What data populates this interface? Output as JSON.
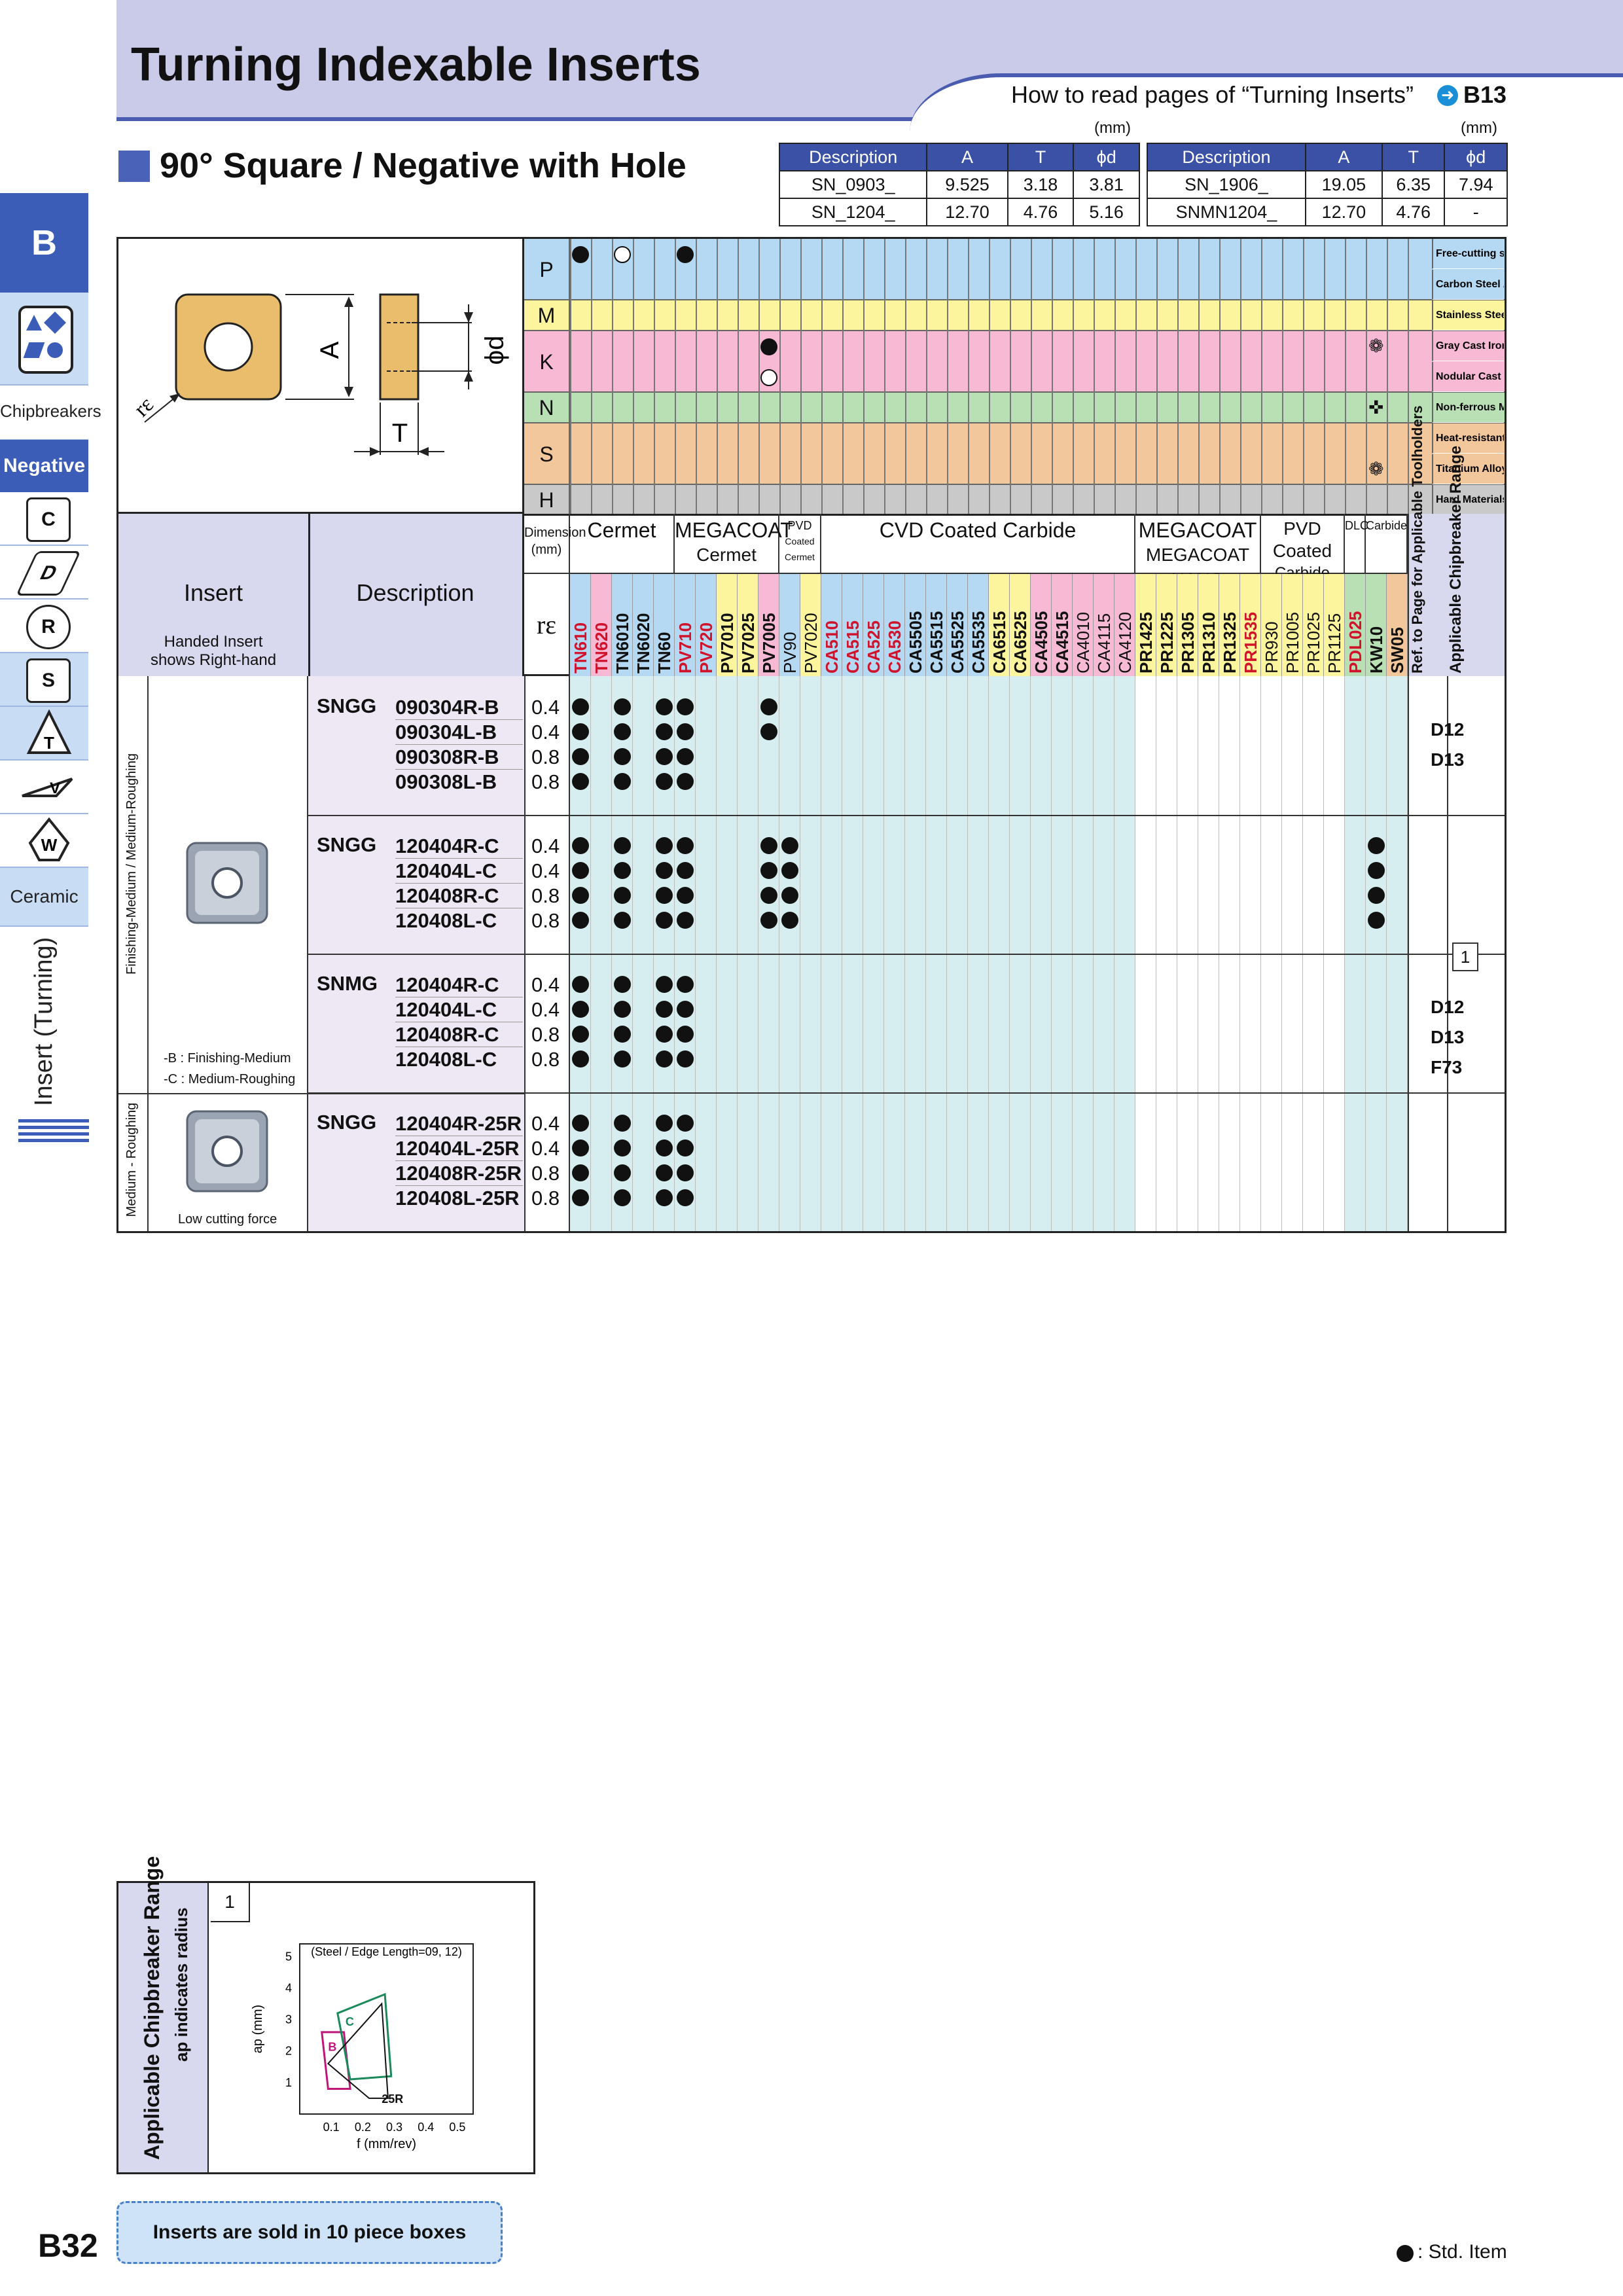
{
  "header": {
    "title": "Turning Indexable Inserts",
    "howto_text": "How to read pages of “Turning Inserts”",
    "howto_ref": "B13",
    "unit": "(mm)"
  },
  "section": {
    "title": "90° Square / Negative with Hole"
  },
  "dim_table": {
    "columns": [
      "Description",
      "A",
      "T",
      "ϕd"
    ],
    "left_rows": [
      [
        "SN_0903_",
        "9.525",
        "3.18",
        "3.81"
      ],
      [
        "SN_1204_",
        "12.70",
        "4.76",
        "5.16"
      ]
    ],
    "right_rows": [
      [
        "SN_1906_",
        "19.05",
        "6.35",
        "7.94"
      ],
      [
        "SNMN1204_",
        "12.70",
        "4.76",
        "-"
      ]
    ]
  },
  "sidebar": {
    "letter": "B",
    "chipbreakers": "Chipbreakers",
    "negative": "Negative",
    "shapes": [
      "C",
      "D",
      "R",
      "S",
      "T",
      "V",
      "W"
    ],
    "ceramic": "Ceramic",
    "vertical": "Insert (Turning)"
  },
  "drawing": {
    "a": "A",
    "t": "T",
    "d": "ϕd",
    "re": "rε"
  },
  "materials": [
    {
      "code": "P",
      "color": "#b5d9f3",
      "labels": [
        "Free-cutting steel",
        "Carbon Steel / Alloy Steel"
      ]
    },
    {
      "code": "M",
      "color": "#fdf59d",
      "labels": [
        "Stainless Steel"
      ]
    },
    {
      "code": "K",
      "color": "#f7b9d4",
      "labels": [
        "Gray Cast Iron",
        "Nodular Cast Iron"
      ]
    },
    {
      "code": "N",
      "color": "#b9dfb4",
      "labels": [
        "Non-ferrous Metals"
      ]
    },
    {
      "code": "S",
      "color": "#f3c79c",
      "labels": [
        "Heat-resistant Alloys",
        "Titanium Alloys"
      ]
    },
    {
      "code": "H",
      "color": "#c9c9c9",
      "labels": [
        "Hard Materials"
      ]
    }
  ],
  "table_header": {
    "insert": "Insert",
    "handed": "Handed Insert\nshows Right-hand",
    "description": "Description",
    "dimension": "Dimension (mm)",
    "re": "rε",
    "ref_page": "Ref. to Page for Applicable Toolholders",
    "chip_range": "Applicable Chipbreaker Range"
  },
  "grade_groups": [
    {
      "name": "Cermet",
      "sub": ""
    },
    {
      "name": "MEGACOAT",
      "sub": "Cermet"
    },
    {
      "name": "PVD",
      "sub": "Coated Cermet"
    },
    {
      "name": "CVD Coated Carbide",
      "sub": ""
    },
    {
      "name": "MEGACOAT",
      "sub": "MEGACOAT NANO"
    },
    {
      "name": "PVD Coated",
      "sub": "Carbide"
    },
    {
      "name": "DLC",
      "sub": ""
    },
    {
      "name": "Carbide",
      "sub": ""
    }
  ],
  "grades": [
    {
      "name": "TN610",
      "red": true
    },
    {
      "name": "TN620",
      "red": true
    },
    {
      "name": "TN6010",
      "red": false
    },
    {
      "name": "TN6020",
      "red": false
    },
    {
      "name": "TN60",
      "red": false
    },
    {
      "name": "PV710",
      "red": true
    },
    {
      "name": "PV720",
      "red": true
    },
    {
      "name": "PV7010",
      "red": false
    },
    {
      "name": "PV7025",
      "red": false
    },
    {
      "name": "PV7005",
      "red": false
    },
    {
      "name": "PV90",
      "red": false
    },
    {
      "name": "PV7020",
      "red": false
    },
    {
      "name": "CA510",
      "red": true
    },
    {
      "name": "CA515",
      "red": true
    },
    {
      "name": "CA525",
      "red": true
    },
    {
      "name": "CA530",
      "red": true
    },
    {
      "name": "CA5505",
      "red": false
    },
    {
      "name": "CA5515",
      "red": false
    },
    {
      "name": "CA5525",
      "red": false
    },
    {
      "name": "CA5535",
      "red": false
    },
    {
      "name": "CA6515",
      "red": false
    },
    {
      "name": "CA6525",
      "red": false
    },
    {
      "name": "CA4505",
      "red": false
    },
    {
      "name": "CA4515",
      "red": false
    },
    {
      "name": "CA4010",
      "red": false
    },
    {
      "name": "CA4115",
      "red": false
    },
    {
      "name": "CA4120",
      "red": false
    },
    {
      "name": "PR1425",
      "red": false
    },
    {
      "name": "PR1225",
      "red": false
    },
    {
      "name": "PR1305",
      "red": false
    },
    {
      "name": "PR1310",
      "red": false
    },
    {
      "name": "PR1325",
      "red": false
    },
    {
      "name": "PR1535",
      "red": true
    },
    {
      "name": "PR930",
      "red": false
    },
    {
      "name": "PR1005",
      "red": false
    },
    {
      "name": "PR1025",
      "red": false
    },
    {
      "name": "PR1125",
      "red": false
    },
    {
      "name": "PDL025",
      "red": true
    },
    {
      "name": "KW10",
      "red": false
    },
    {
      "name": "SW05",
      "red": false
    }
  ],
  "row_groups": [
    {
      "series": "SNGG",
      "rows": [
        {
          "code": "090304R-B",
          "re": "0.4"
        },
        {
          "code": "090304L-B",
          "re": "0.4"
        },
        {
          "code": "090308R-B",
          "re": "0.8"
        },
        {
          "code": "090308L-B",
          "re": "0.8"
        }
      ],
      "refs": [
        "D12",
        "D13"
      ]
    },
    {
      "series": "SNGG",
      "rows": [
        {
          "code": "120404R-C",
          "re": "0.4"
        },
        {
          "code": "120404L-C",
          "re": "0.4"
        },
        {
          "code": "120408R-C",
          "re": "0.8"
        },
        {
          "code": "120408L-C",
          "re": "0.8"
        }
      ],
      "refs": []
    },
    {
      "series": "SNMG",
      "rows": [
        {
          "code": "120404R-C",
          "re": "0.4"
        },
        {
          "code": "120404L-C",
          "re": "0.4"
        },
        {
          "code": "120408R-C",
          "re": "0.8"
        },
        {
          "code": "120408L-C",
          "re": "0.8"
        }
      ],
      "refs": [
        "D12",
        "D13",
        "F73"
      ]
    },
    {
      "series": "SNGG",
      "rows": [
        {
          "code": "120404R-25R",
          "re": "0.4"
        },
        {
          "code": "120404L-25R",
          "re": "0.4"
        },
        {
          "code": "120408R-25R",
          "re": "0.8"
        },
        {
          "code": "120408L-25R",
          "re": "0.8"
        }
      ],
      "refs": []
    }
  ],
  "range_ref": "1",
  "category_labels": {
    "fm": "Finishing-Medium / Medium-Roughing",
    "mr": "Medium - Roughing",
    "note_b": "-B : Finishing-Medium",
    "note_c": "-C : Medium-Roughing",
    "low_force": "Low cutting force"
  },
  "chip_chart": {
    "box_title": "Applicable Chipbreaker Range",
    "box_sub": "ap indicates radius",
    "ref": "1",
    "caption": "(Steel / Edge Length=09, 12)",
    "xlabel": "f (mm/rev)",
    "ylabel": "ap (mm)",
    "xticks": [
      "0.1",
      "0.2",
      "0.3",
      "0.4",
      "0.5"
    ],
    "yticks": [
      "1",
      "2",
      "3",
      "4",
      "5"
    ],
    "regions": [
      {
        "label": "B",
        "color": "#c0167a"
      },
      {
        "label": "C",
        "color": "#1a8a5a"
      },
      {
        "label": "25R",
        "color": "#111111"
      }
    ]
  },
  "note": "Inserts are sold in 10 piece boxes",
  "page_number": "B32",
  "std_item": ": Std. Item"
}
